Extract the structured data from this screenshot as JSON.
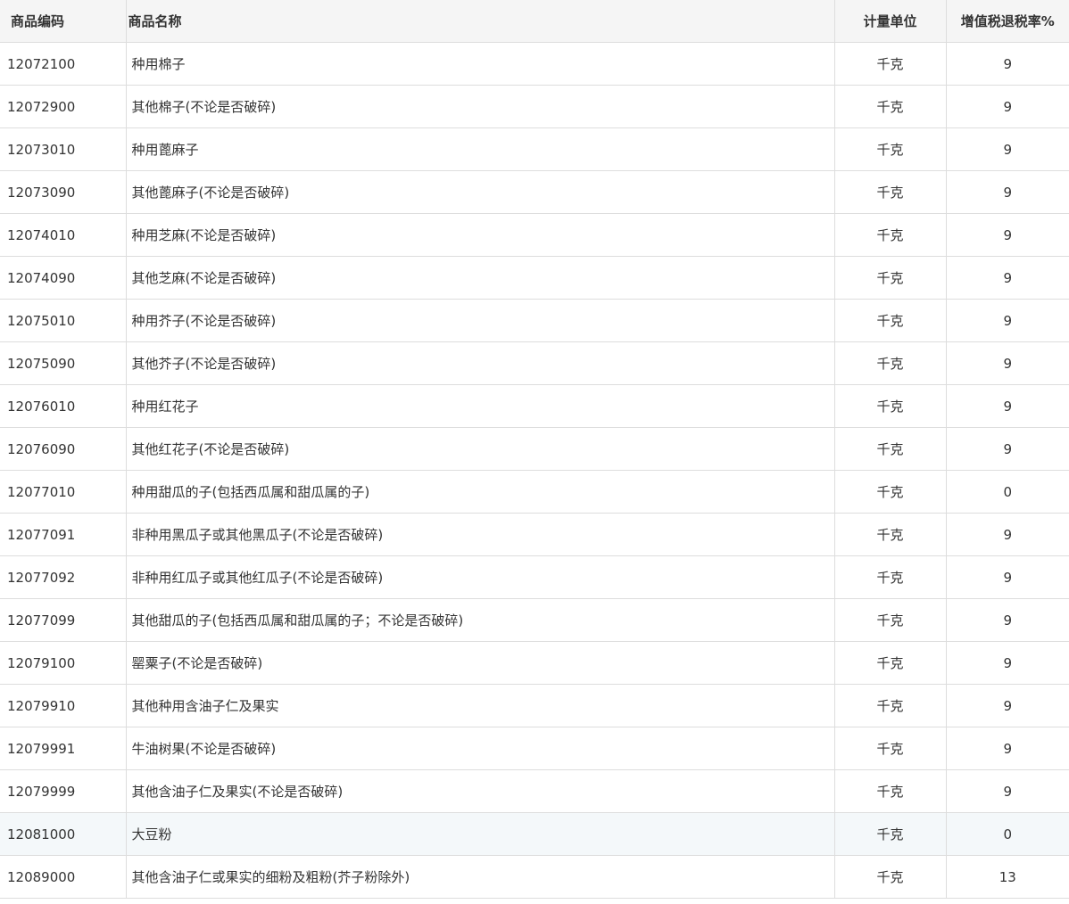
{
  "table": {
    "headers": {
      "code": "商品编码",
      "name": "商品名称",
      "unit": "计量单位",
      "rate": "增值税退税率%"
    },
    "rows": [
      {
        "code": "12072100",
        "name": "种用棉子",
        "unit": "千克",
        "rate": "9"
      },
      {
        "code": "12072900",
        "name": "其他棉子(不论是否破碎)",
        "unit": "千克",
        "rate": "9"
      },
      {
        "code": "12073010",
        "name": "种用蓖麻子",
        "unit": "千克",
        "rate": "9"
      },
      {
        "code": "12073090",
        "name": "其他蓖麻子(不论是否破碎)",
        "unit": "千克",
        "rate": "9"
      },
      {
        "code": "12074010",
        "name": "种用芝麻(不论是否破碎)",
        "unit": "千克",
        "rate": "9"
      },
      {
        "code": "12074090",
        "name": "其他芝麻(不论是否破碎)",
        "unit": "千克",
        "rate": "9"
      },
      {
        "code": "12075010",
        "name": "种用芥子(不论是否破碎)",
        "unit": "千克",
        "rate": "9"
      },
      {
        "code": "12075090",
        "name": "其他芥子(不论是否破碎)",
        "unit": "千克",
        "rate": "9"
      },
      {
        "code": "12076010",
        "name": "种用红花子",
        "unit": "千克",
        "rate": "9"
      },
      {
        "code": "12076090",
        "name": "其他红花子(不论是否破碎)",
        "unit": "千克",
        "rate": "9"
      },
      {
        "code": "12077010",
        "name": "种用甜瓜的子(包括西瓜属和甜瓜属的子)",
        "unit": "千克",
        "rate": "0"
      },
      {
        "code": "12077091",
        "name": "非种用黑瓜子或其他黑瓜子(不论是否破碎)",
        "unit": "千克",
        "rate": "9"
      },
      {
        "code": "12077092",
        "name": "非种用红瓜子或其他红瓜子(不论是否破碎)",
        "unit": "千克",
        "rate": "9"
      },
      {
        "code": "12077099",
        "name": "其他甜瓜的子(包括西瓜属和甜瓜属的子；不论是否破碎)",
        "unit": "千克",
        "rate": "9"
      },
      {
        "code": "12079100",
        "name": "罂粟子(不论是否破碎)",
        "unit": "千克",
        "rate": "9"
      },
      {
        "code": "12079910",
        "name": "其他种用含油子仁及果实",
        "unit": "千克",
        "rate": "9"
      },
      {
        "code": "12079991",
        "name": "牛油树果(不论是否破碎)",
        "unit": "千克",
        "rate": "9"
      },
      {
        "code": "12079999",
        "name": "其他含油子仁及果实(不论是否破碎)",
        "unit": "千克",
        "rate": "9"
      },
      {
        "code": "12081000",
        "name": "大豆粉",
        "unit": "千克",
        "rate": "0"
      },
      {
        "code": "12089000",
        "name": "其他含油子仁或果实的细粉及粗粉(芥子粉除外)",
        "unit": "千克",
        "rate": "13"
      }
    ],
    "hovered_row_code": "12081000"
  }
}
